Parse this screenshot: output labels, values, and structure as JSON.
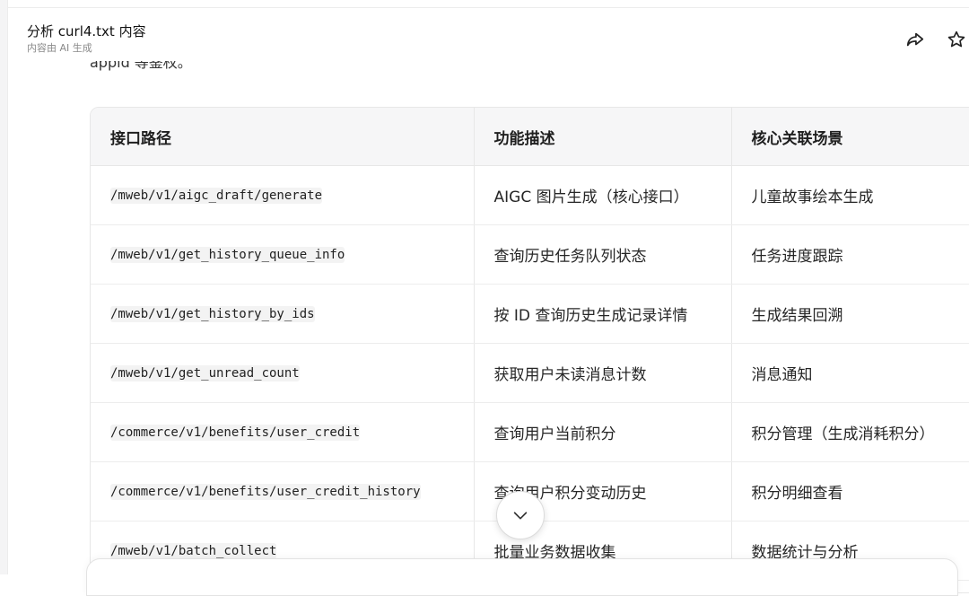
{
  "header": {
    "title": "分析 curl4.txt 内容",
    "subtitle": "内容由 AI 生成"
  },
  "icons": {
    "share": "share-icon",
    "star": "star-icon",
    "scroll_down": "chevron-down-icon"
  },
  "preceding_text": "appid 等鉴权。",
  "table": {
    "headers": [
      "接口路径",
      "功能描述",
      "核心关联场景"
    ],
    "rows": [
      [
        "/mweb/v1/aigc_draft/generate",
        "AIGC 图片生成（核心接口）",
        "儿童故事绘本生成"
      ],
      [
        "/mweb/v1/get_history_queue_info",
        "查询历史任务队列状态",
        "任务进度跟踪"
      ],
      [
        "/mweb/v1/get_history_by_ids",
        "按 ID 查询历史生成记录详情",
        "生成结果回溯"
      ],
      [
        "/mweb/v1/get_unread_count",
        "获取用户未读消息计数",
        "消息通知"
      ],
      [
        "/commerce/v1/benefits/user_credit",
        "查询用户当前积分",
        "积分管理（生成消耗积分）"
      ],
      [
        "/commerce/v1/benefits/user_credit_history",
        "查询用户积分变动历史",
        "积分明细查看"
      ],
      [
        "/mweb/v1/batch_collect",
        "批量业务数据收集",
        "数据统计与分析"
      ]
    ]
  }
}
